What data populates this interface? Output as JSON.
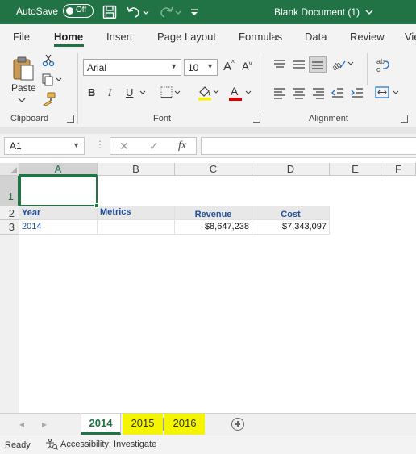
{
  "titlebar": {
    "autosave_label": "AutoSave",
    "autosave_state": "Off",
    "document_title": "Blank Document (1)",
    "bg_color": "#217346"
  },
  "menu": {
    "tabs": [
      "File",
      "Home",
      "Insert",
      "Page Layout",
      "Formulas",
      "Data",
      "Review",
      "Vie"
    ],
    "active": "Home"
  },
  "ribbon": {
    "clipboard": {
      "paste_label": "Paste",
      "group_label": "Clipboard"
    },
    "font": {
      "font_name": "Arial",
      "font_size": "10",
      "group_label": "Font",
      "bold": "B",
      "italic": "I",
      "underline": "U",
      "font_color_letter": "A"
    },
    "alignment": {
      "group_label": "Alignment"
    }
  },
  "formula_bar": {
    "name_box": "A1",
    "fx": "fx",
    "formula": ""
  },
  "grid": {
    "columns": [
      "A",
      "B",
      "C",
      "D",
      "E",
      "F"
    ],
    "rows": [
      "1",
      "2",
      "3"
    ],
    "selected_cell": "A1",
    "header_row": {
      "year": "Year",
      "metrics": "Metrics",
      "revenue": "Revenue",
      "cost": "Cost"
    },
    "data_row": {
      "year": "2014",
      "revenue": "$8,647,238",
      "cost": "$7,343,097"
    }
  },
  "sheets": {
    "tabs": [
      "2014",
      "2015",
      "2016"
    ],
    "active": "2014",
    "highlight_color": "#f5f500"
  },
  "status": {
    "ready": "Ready",
    "accessibility": "Accessibility: Investigate"
  }
}
